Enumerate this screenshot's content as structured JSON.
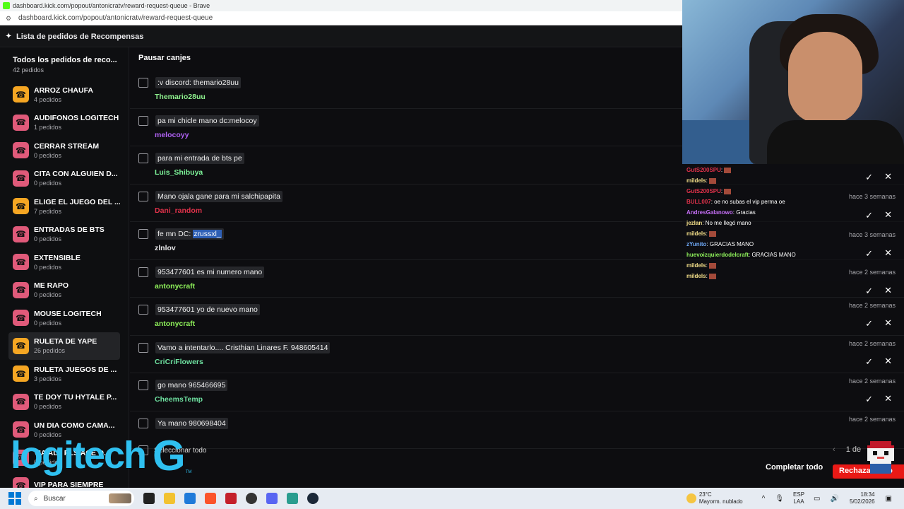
{
  "browser": {
    "title": "dashboard.kick.com/popout/antonicratv/reward-request-queue - Brave",
    "url": "dashboard.kick.com/popout/antonicratv/reward-request-queue"
  },
  "header": {
    "title": "Lista de pedidos de Recompensas"
  },
  "sidebar": {
    "all": {
      "title": "Todos los pedidos de reco...",
      "count": "42 pedidos"
    },
    "items": [
      {
        "label": "ARROZ CHAUFA",
        "count": "4 pedidos",
        "color": "#f5a623"
      },
      {
        "label": "AUDIFONOS LOGITECH",
        "count": "1 pedidos",
        "color": "#e05a7a"
      },
      {
        "label": "CERRAR STREAM",
        "count": "0 pedidos",
        "color": "#e05a7a"
      },
      {
        "label": "CITA CON ALGUIEN D...",
        "count": "0 pedidos",
        "color": "#e05a7a"
      },
      {
        "label": "ELIGE EL JUEGO DEL ...",
        "count": "7 pedidos",
        "color": "#f5a623"
      },
      {
        "label": "ENTRADAS DE BTS",
        "count": "0 pedidos",
        "color": "#e05a7a"
      },
      {
        "label": "EXTENSIBLE",
        "count": "0 pedidos",
        "color": "#e05a7a"
      },
      {
        "label": "ME RAPO",
        "count": "0 pedidos",
        "color": "#e05a7a"
      },
      {
        "label": "MOUSE LOGITECH",
        "count": "0 pedidos",
        "color": "#e05a7a"
      },
      {
        "label": "RULETA DE YAPE",
        "count": "26 pedidos",
        "color": "#f5a623"
      },
      {
        "label": "RULETA JUEGOS DE ...",
        "count": "3 pedidos",
        "color": "#f5a623"
      },
      {
        "label": "TE DOY TU HYTALE P...",
        "count": "0 pedidos",
        "color": "#e05a7a"
      },
      {
        "label": "UN DIA COMO CAMA...",
        "count": "0 pedidos",
        "color": "#e05a7a"
      },
      {
        "label": "VIA ALL PLS ACE O...",
        "count": "0 pedidos",
        "color": "#e05a7a"
      },
      {
        "label": "VIP PARA SIEMPRE",
        "count": "",
        "color": "#e05a7a"
      }
    ]
  },
  "main": {
    "pause_label": "Pausar canjes",
    "requests": [
      {
        "message": ":v discord: themario28uu",
        "user": "Themario28uu",
        "user_color": "#8ef08e",
        "time": ""
      },
      {
        "message": "pa mi chicle mano dc:melocoy",
        "user": "melocoyy",
        "user_color": "#b162f5",
        "time": ""
      },
      {
        "message": "para mi entrada de bts pe",
        "user": "Luis_Shibuya",
        "user_color": "#7ef59a",
        "time": ""
      },
      {
        "message": "Mano ojala gane para mi salchipapita",
        "user": "Dani_random",
        "user_color": "#e0324a",
        "time": ""
      },
      {
        "message_prefix": "fe mn DC: ",
        "message_highlight": "zrussxl_",
        "user": "zlnlov",
        "user_color": "#e8e8ea",
        "time": ""
      },
      {
        "message": "953477601 es mi numero mano",
        "user": "antonycraft",
        "user_color": "#8ef05a",
        "time": ""
      },
      {
        "message": "953477601 yo de nuevo mano",
        "user": "antonycraft",
        "user_color": "#8ef05a",
        "time": "hace 2 semanas"
      },
      {
        "message": "Vamo a intentarlo.... Cristhian Linares F. 948605414",
        "user": "CriCriFlowers",
        "user_color": "#6ee0a0",
        "time": "hace 2 semanas"
      },
      {
        "message": "go mano 965466695",
        "user": "CheemsTemp",
        "user_color": "#6ee0a0",
        "time": "hace 2 semanas"
      },
      {
        "message": "Ya mano 980698404",
        "user": "",
        "user_color": "#e8e8ea",
        "time": "hace 2 semanas"
      }
    ],
    "select_all": "Seleccionar todo",
    "pager": "1 de",
    "complete_all": "Completar todo",
    "reject_all": "Rechazar todo"
  },
  "chat": [
    {
      "name": "GutS200SPU",
      "text": ":",
      "name_color": "#e0324a",
      "emote": true
    },
    {
      "name": "mildels",
      "text": ":",
      "name_color": "#f5e08a",
      "emote": true
    },
    {
      "name": "GutS200SPU",
      "text": ":",
      "name_color": "#e0324a",
      "emote": true
    },
    {
      "name": "BULL007",
      "text": ": oe no subas el vip perma oe",
      "name_color": "#e0324a",
      "emote": false
    },
    {
      "name": "AndresGalanowo",
      "text": ": Gracias",
      "name_color": "#c46ef5",
      "emote": false
    },
    {
      "name": "jezlan",
      "text": ": No me llegó mano",
      "name_color": "#f5e08a",
      "emote": false
    },
    {
      "name": "mildels",
      "text": ":",
      "name_color": "#f5e08a",
      "emote": true
    },
    {
      "name": "zYunito",
      "text": ": GRACIAS MANO",
      "name_color": "#6ea8f5",
      "emote": false
    },
    {
      "name": "huevoizquierdodelcraft",
      "text": ": GRACIAS MANO",
      "name_color": "#8ef05a",
      "emote": false
    },
    {
      "name": "mildels",
      "text": ":",
      "name_color": "#f5e08a",
      "emote": true
    },
    {
      "name": "mildels",
      "text": ":",
      "name_color": "#f5e08a",
      "emote": true
    }
  ],
  "chat_times": [
    "hace 3 semanas",
    "hace 3 semanas",
    "hace 2 semanas"
  ],
  "sponsor": {
    "wordmark": "logitech",
    "mark": "G",
    "tm": "TM"
  },
  "taskbar": {
    "search_placeholder": "Buscar",
    "weather_temp": "23°C",
    "weather_desc": "Mayorm. nublado",
    "lang_top": "ESP",
    "lang_bottom": "LAA",
    "time": "18:34",
    "date": "5/02/2026"
  }
}
